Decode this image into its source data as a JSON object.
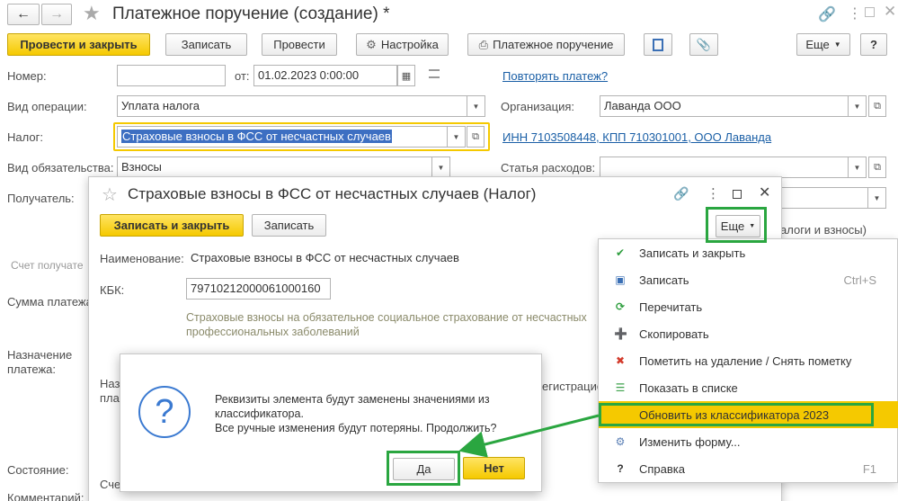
{
  "window": {
    "title": "Платежное поручение (создание) *"
  },
  "toolbar": {
    "post_close": "Провести и закрыть",
    "save": "Записать",
    "post": "Провести",
    "settings": "Настройка",
    "payment_order": "Платежное поручение",
    "more": "Еще",
    "help": "?"
  },
  "form": {
    "number_label": "Номер:",
    "number_value": "",
    "from_label": "от:",
    "date_value": "01.02.2023  0:00:00",
    "repeat_link": "Повторять платеж?",
    "operation_label": "Вид операции:",
    "operation_value": "Уплата налога",
    "org_label": "Организация:",
    "org_value": "Лаванда ООО",
    "tax_label": "Налог:",
    "tax_value": "Страховые взносы в ФСС от несчастных случаев",
    "inn_link": "ИНН 7103508448, КПП 710301001, ООО Лаванда",
    "obligation_label": "Вид обязательства:",
    "obligation_value": "Взносы",
    "expense_label": "Статья расходов:",
    "expense_value": "",
    "recipient_label": "Получатель:",
    "recipient_account_label": "Счет получате",
    "amount_label": "Сумма платежа",
    "purpose_label_1": "Назначение",
    "purpose_label_2": "платежа:",
    "state_label": "Состояние:",
    "comment_label": "Комментарий:",
    "right_partial_text": "алоги и взносы)"
  },
  "tax_window": {
    "title": "Страховые взносы в ФСС от несчастных случаев (Налог)",
    "save_close": "Записать и закрыть",
    "save": "Записать",
    "more": "Еще",
    "name_label": "Наименование:",
    "name_value": "Страховые взносы в ФСС от несчастных случаев",
    "kbk_label": "КБК:",
    "kbk_value": "79710212000061000160",
    "description": "Страховые взносы на обязательное социальное страхование от несчастных",
    "description_2": "профессиональных заболеваний",
    "partial_na": "Наз",
    "partial_pl": "пла",
    "partial_sch": "Сче",
    "partial_reg": "егистрацио"
  },
  "more_menu": {
    "items": [
      {
        "label": "Записать и закрыть",
        "shortcut": "",
        "icon": "save-close-icon",
        "color": "#2e9e3e"
      },
      {
        "label": "Записать",
        "shortcut": "Ctrl+S",
        "icon": "floppy-icon",
        "color": "#3a6fb5"
      },
      {
        "label": "Перечитать",
        "shortcut": "",
        "icon": "refresh-icon",
        "color": "#2e9e3e"
      },
      {
        "label": "Скопировать",
        "shortcut": "",
        "icon": "copy-icon",
        "color": "#3fa34d"
      },
      {
        "label": "Пометить на удаление / Снять пометку",
        "shortcut": "",
        "icon": "delete-mark-icon",
        "color": "#d33b2c"
      },
      {
        "label": "Показать в списке",
        "shortcut": "",
        "icon": "list-icon",
        "color": "#3fa34d"
      },
      {
        "label": "Обновить из классификатора 2023",
        "shortcut": "",
        "icon": "",
        "color": ""
      },
      {
        "label": "Изменить форму...",
        "shortcut": "",
        "icon": "form-edit-icon",
        "color": "#5a7fb5"
      },
      {
        "label": "Справка",
        "shortcut": "F1",
        "icon": "help-icon",
        "color": "#333"
      }
    ]
  },
  "dialog": {
    "message_1": "Реквизиты элемента будут заменены значениями из",
    "message_2": "классификатора.",
    "message_3": "Все ручные изменения будут потеряны. Продолжить?",
    "yes": "Да",
    "no": "Нет"
  },
  "colors": {
    "accent_yellow": "#f5c900",
    "highlight_green": "#2aa640",
    "link_blue": "#1a5fa6"
  }
}
